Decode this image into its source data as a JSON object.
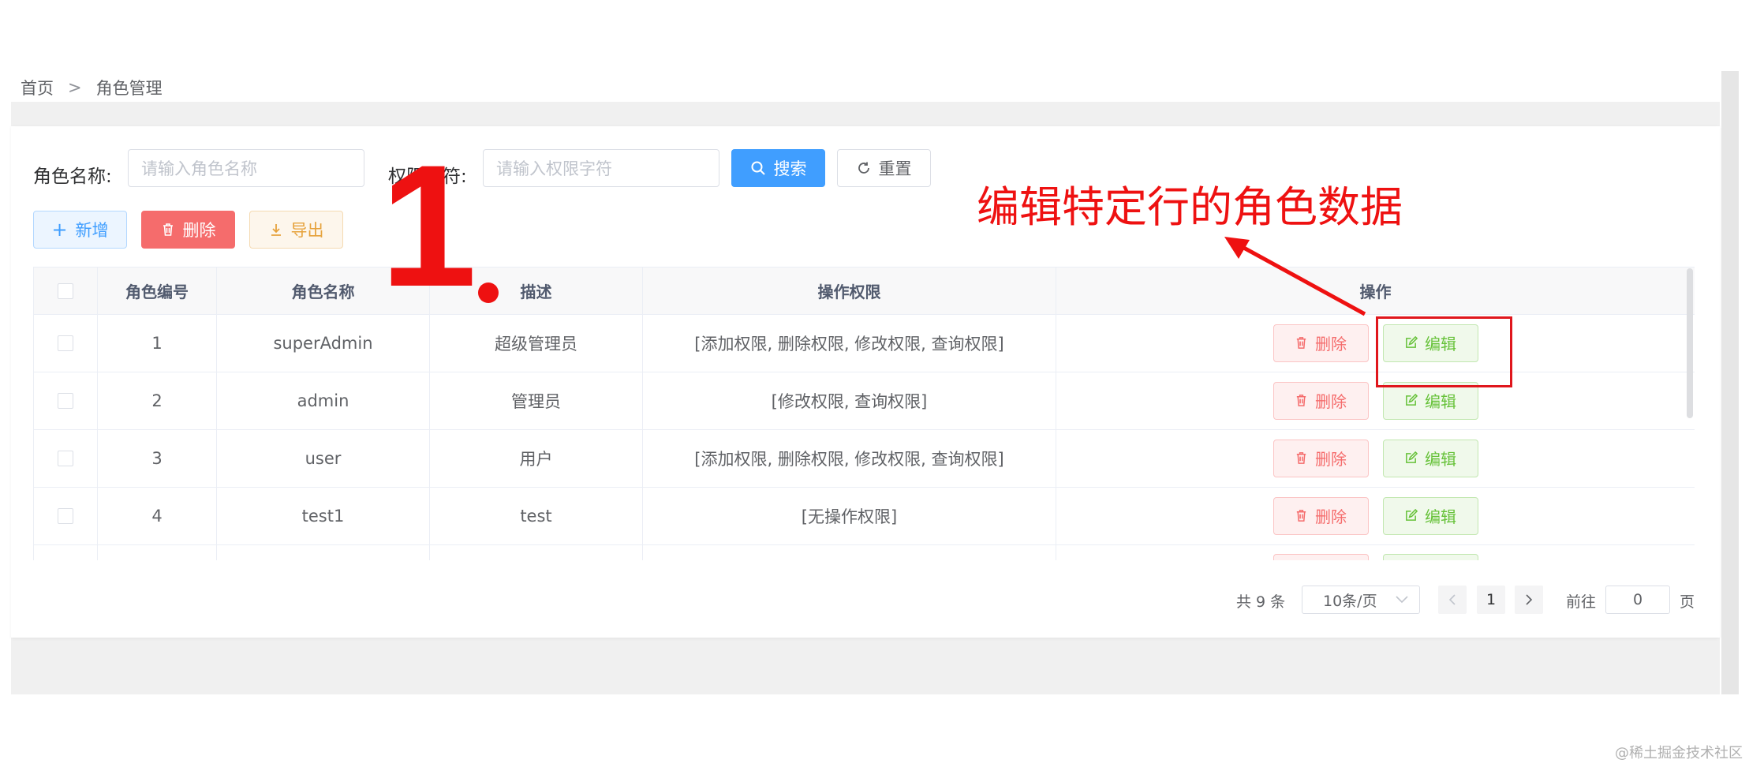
{
  "breadcrumb": {
    "home": "首页",
    "separator": ">",
    "current": "角色管理"
  },
  "search": {
    "role_name_label": "角色名称:",
    "role_name_placeholder": "请输入角色名称",
    "perm_label": "权限字符:",
    "perm_placeholder": "请输入权限字符",
    "search_button": "搜索",
    "reset_button": "重置"
  },
  "toolbar": {
    "add_label": "新增",
    "delete_label": "删除",
    "export_label": "导出"
  },
  "table": {
    "columns": [
      "角色编号",
      "角色名称",
      "描述",
      "操作权限",
      "操作"
    ],
    "rows": [
      {
        "id": "1",
        "name": "superAdmin",
        "desc": "超级管理员",
        "perms": "[添加权限, 删除权限, 修改权限, 查询权限]"
      },
      {
        "id": "2",
        "name": "admin",
        "desc": "管理员",
        "perms": "[修改权限, 查询权限]"
      },
      {
        "id": "3",
        "name": "user",
        "desc": "用户",
        "perms": "[添加权限, 删除权限, 修改权限, 查询权限]"
      },
      {
        "id": "4",
        "name": "test1",
        "desc": "test",
        "perms": "[无操作权限]"
      }
    ],
    "row_delete_label": "删除",
    "row_edit_label": "编辑"
  },
  "pagination": {
    "total": "共 9 条",
    "page_size": "10条/页",
    "current_page": "1",
    "goto_label": "前往",
    "goto_value": "0",
    "page_suffix": "页"
  },
  "annotation": {
    "number": "1",
    "text": "编辑特定行的角色数据",
    "color": "#ee1111"
  },
  "watermark": "@稀土掘金技术社区",
  "icons": [
    "search-icon",
    "refresh-icon",
    "plus-icon",
    "trash-icon",
    "download-icon",
    "edit-icon",
    "chevron-left-icon",
    "chevron-right-icon",
    "chevron-down-icon"
  ]
}
